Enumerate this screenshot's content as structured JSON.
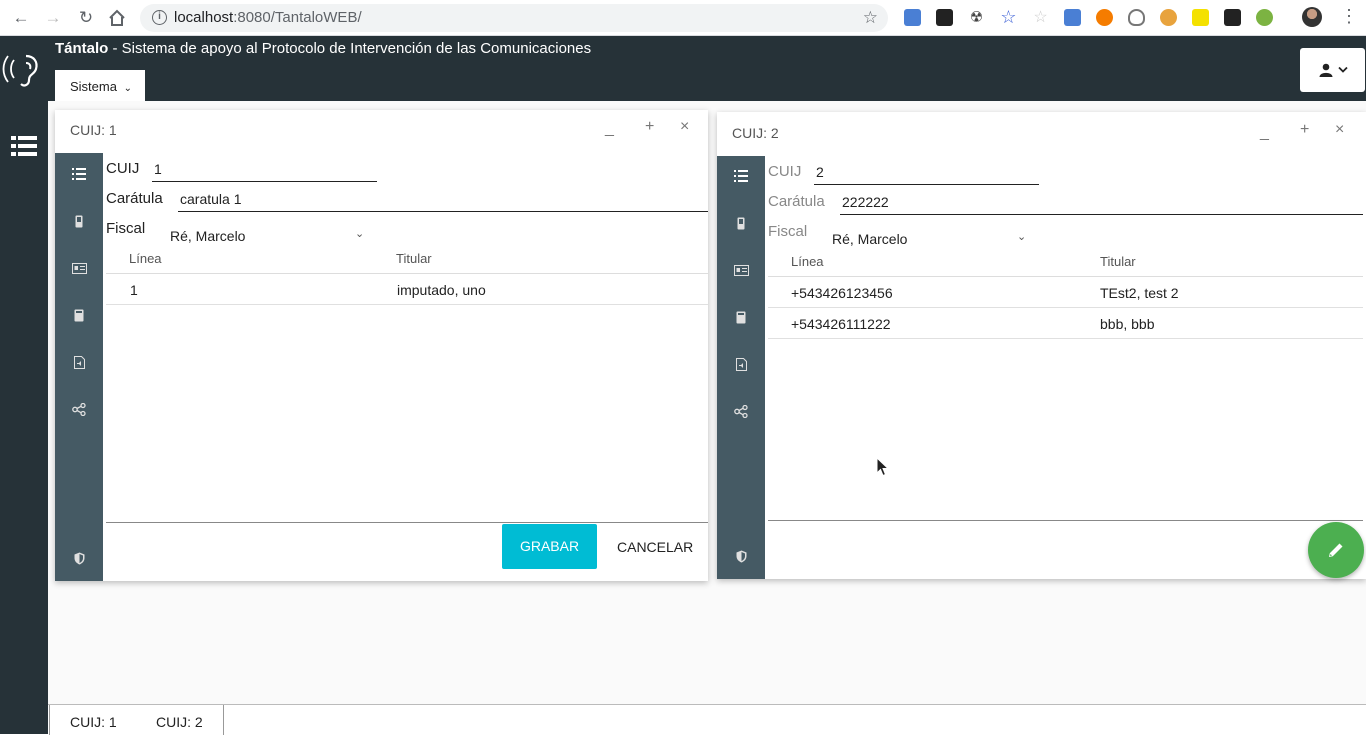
{
  "browser": {
    "url_host": "localhost",
    "url_rest": ":8080/TantaloWEB/"
  },
  "app": {
    "title_bold": "Tántalo",
    "title_rest": " - Sistema de apoyo al Protocolo de Intervención de las Comunicaciones",
    "menu_sistema": "Sistema"
  },
  "windows": [
    {
      "title": "CUIJ: 1",
      "fields": {
        "cuij_label": "CUIJ",
        "cuij_value": "1",
        "caratula_label": "Carátula",
        "caratula_value": "caratula 1",
        "fiscal_label": "Fiscal",
        "fiscal_value": "Ré, Marcelo"
      },
      "table": {
        "headers": [
          "Línea",
          "Titular"
        ],
        "rows": [
          [
            "1",
            "imputado, uno"
          ]
        ]
      },
      "buttons": {
        "save": "GRABAR",
        "cancel": "CANCELAR"
      }
    },
    {
      "title": "CUIJ: 2",
      "fields": {
        "cuij_label": "CUIJ",
        "cuij_value": "2",
        "caratula_label": "Carátula",
        "caratula_value": "222222",
        "fiscal_label": "Fiscal",
        "fiscal_value": "Ré, Marcelo"
      },
      "table": {
        "headers": [
          "Línea",
          "Titular"
        ],
        "rows": [
          [
            "+543426123456",
            "TEst2, test 2"
          ],
          [
            "+543426111222",
            "bbb, bbb"
          ]
        ]
      }
    }
  ],
  "taskbar": {
    "items": [
      "CUIJ: 1",
      "CUIJ: 2"
    ]
  },
  "colors": {
    "header_bg": "#263238",
    "sidebar_bg": "#455a64",
    "accent_cyan": "#00bcd4",
    "fab_green": "#4caf50"
  }
}
